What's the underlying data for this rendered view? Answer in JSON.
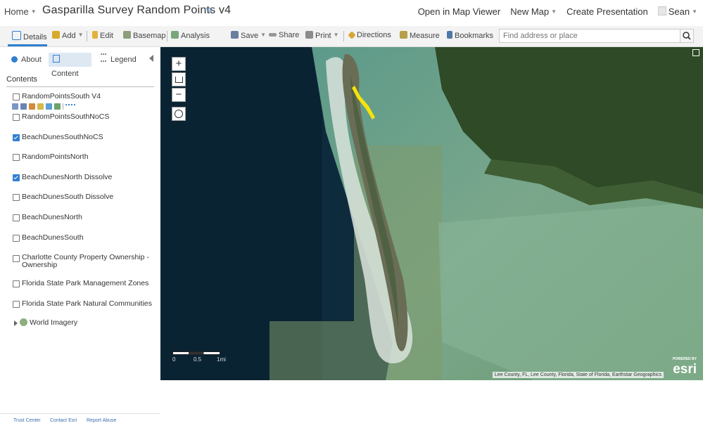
{
  "topbar": {
    "home": "Home",
    "title": "Gasparilla Survey Random Points v4",
    "open_viewer": "Open in Map Viewer",
    "new_map": "New Map",
    "create_presentation": "Create Presentation",
    "user": "Sean"
  },
  "toolbar": {
    "details": "Details",
    "add": "Add",
    "edit": "Edit",
    "basemap": "Basemap",
    "analysis": "Analysis",
    "save": "Save",
    "share": "Share",
    "print": "Print",
    "directions": "Directions",
    "measure": "Measure",
    "bookmarks": "Bookmarks",
    "search_placeholder": "Find address or place"
  },
  "sidebar": {
    "tabs": [
      "About",
      "Content",
      "Legend"
    ],
    "active_tab": "Content",
    "contents_heading": "Contents",
    "layers": [
      {
        "label": "RandomPointsSouth V4",
        "checked": false
      },
      {
        "label": "RandomPointsSouthNoCS",
        "checked": false
      },
      {
        "label": "BeachDunesSouthNoCS",
        "checked": true
      },
      {
        "label": "RandomPointsNorth",
        "checked": false
      },
      {
        "label": "BeachDunesNorth Dissolve",
        "checked": true
      },
      {
        "label": "BeachDunesSouth Dissolve",
        "checked": false
      },
      {
        "label": "BeachDunesNorth",
        "checked": false
      },
      {
        "label": "BeachDunesSouth",
        "checked": false
      },
      {
        "label": "Charlotte County Property Ownership - Ownership",
        "checked": false
      },
      {
        "label": "Florida State Park Management Zones",
        "checked": false
      },
      {
        "label": "Florida State Park Natural Communities",
        "checked": false
      }
    ],
    "basemap_layer": "World Imagery",
    "footer": [
      "Trust Center",
      "Contact Esri",
      "Report Abuse"
    ]
  },
  "map": {
    "zoom_in": "+",
    "zoom_out": "−",
    "scale": {
      "l0": "0",
      "l1": "0.5",
      "l2": "1mi"
    },
    "attribution": "Lee County, FL, Lee County, Florida, State of Florida, Earthstar Geographics",
    "logo_small": "POWERED BY",
    "logo": "esri"
  },
  "colors": {
    "accent": "#2f7fd0",
    "active_tab_bg": "#dde8f3",
    "toolbar_bg": "#f3f3f3",
    "deep_water": "#0e2b3d",
    "shallow_water": "#6fa38f",
    "land": "#2f4a26",
    "points": "#f5e40a"
  }
}
